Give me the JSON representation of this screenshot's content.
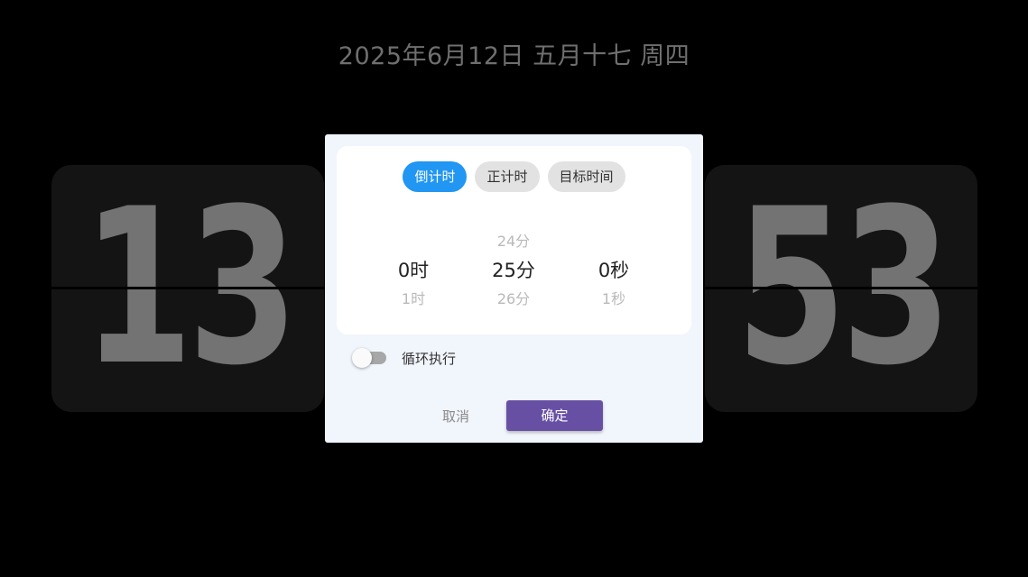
{
  "header": {
    "date_text": "2025年6月12日 五月十七 周四"
  },
  "clock": {
    "left_digits": "13",
    "right_digits": "53"
  },
  "dialog": {
    "tabs": [
      {
        "label": "倒计时",
        "active": true
      },
      {
        "label": "正计时",
        "active": false
      },
      {
        "label": "目标时间",
        "active": false
      }
    ],
    "picker": {
      "hours": {
        "above": "",
        "selected": "0时",
        "below": "1时"
      },
      "minutes": {
        "above": "24分",
        "selected": "25分",
        "below": "26分"
      },
      "seconds": {
        "above": "",
        "selected": "0秒",
        "below": "1秒"
      }
    },
    "loop": {
      "label": "循环执行",
      "enabled": false
    },
    "buttons": {
      "cancel": "取消",
      "confirm": "确定"
    }
  },
  "colors": {
    "background": "#000000",
    "active_tab": "#2196f3",
    "confirm_button": "#6750a4",
    "dialog_background": "#f1f5fc"
  }
}
